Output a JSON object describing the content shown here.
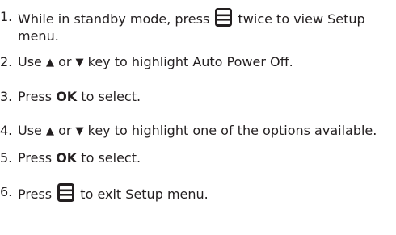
{
  "steps": [
    {
      "number": "1.",
      "before_icon": "While in standby mode, press",
      "icon": "menu-icon",
      "after_icon": "twice to view Setup menu."
    },
    {
      "number": "2.",
      "text_a": "Use",
      "up_arrow": "▲",
      "text_b": "or",
      "down_arrow": "▼",
      "text_c": "key to highlight Auto Power Off."
    },
    {
      "number": "3.",
      "text_a": "Press",
      "bold": "OK",
      "text_b": "to select."
    },
    {
      "number": "4.",
      "text_a": "Use",
      "up_arrow": "▲",
      "text_b": "or",
      "down_arrow": "▼",
      "text_c": "key to highlight one of the options available."
    },
    {
      "number": "5.",
      "text_a": "Press",
      "bold": "OK",
      "text_b": "to select."
    },
    {
      "number": "6.",
      "text_a": "Press",
      "icon": "menu-icon",
      "text_b": "to exit Setup menu."
    }
  ]
}
